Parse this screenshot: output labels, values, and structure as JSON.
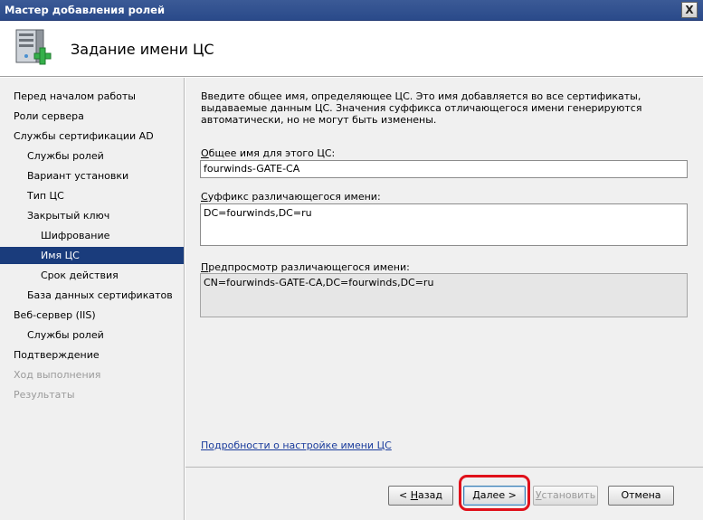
{
  "window": {
    "title": "Мастер добавления ролей",
    "close_label": "X"
  },
  "header": {
    "page_title": "Задание имени ЦС",
    "icon": "server-add-icon"
  },
  "sidebar": {
    "items": [
      {
        "label": "Перед началом работы",
        "level": 0,
        "state": "normal"
      },
      {
        "label": "Роли сервера",
        "level": 0,
        "state": "normal"
      },
      {
        "label": "Службы сертификации AD",
        "level": 0,
        "state": "normal"
      },
      {
        "label": "Службы ролей",
        "level": 1,
        "state": "normal"
      },
      {
        "label": "Вариант установки",
        "level": 1,
        "state": "normal"
      },
      {
        "label": "Тип ЦС",
        "level": 1,
        "state": "normal"
      },
      {
        "label": "Закрытый ключ",
        "level": 1,
        "state": "normal"
      },
      {
        "label": "Шифрование",
        "level": 2,
        "state": "normal"
      },
      {
        "label": "Имя ЦС",
        "level": 2,
        "state": "selected"
      },
      {
        "label": "Срок действия",
        "level": 2,
        "state": "normal"
      },
      {
        "label": "База данных сертификатов",
        "level": 1,
        "state": "normal"
      },
      {
        "label": "Веб-сервер (IIS)",
        "level": 0,
        "state": "normal"
      },
      {
        "label": "Службы ролей",
        "level": 1,
        "state": "normal"
      },
      {
        "label": "Подтверждение",
        "level": 0,
        "state": "normal"
      },
      {
        "label": "Ход выполнения",
        "level": 0,
        "state": "disabled"
      },
      {
        "label": "Результаты",
        "level": 0,
        "state": "disabled"
      }
    ]
  },
  "main": {
    "intro": "Введите общее имя, определяющее ЦС. Это имя добавляется во все сертификаты, выдаваемые данным ЦС. Значения суффикса отличающегося имени генерируются автоматически, но не могут быть изменены.",
    "common_name": {
      "label_key": "О",
      "label_rest": "бщее имя для этого ЦС:",
      "value": "fourwinds-GATE-CA"
    },
    "suffix": {
      "label_key": "С",
      "label_rest": "уффикс различающегося имени:",
      "value": "DC=fourwinds,DC=ru"
    },
    "preview": {
      "label_key": "П",
      "label_rest": "редпросмотр различающегося имени:",
      "value": "CN=fourwinds-GATE-CA,DC=fourwinds,DC=ru"
    },
    "help_link": "Подробности о настройке имени ЦС"
  },
  "footer": {
    "back": {
      "prefix": "< ",
      "key": "Н",
      "rest": "азад"
    },
    "next": {
      "key": "Д",
      "rest": "алее >"
    },
    "install": {
      "key": "У",
      "rest": "становить"
    },
    "cancel": "Отмена",
    "highlight_color": "#e0101a"
  }
}
